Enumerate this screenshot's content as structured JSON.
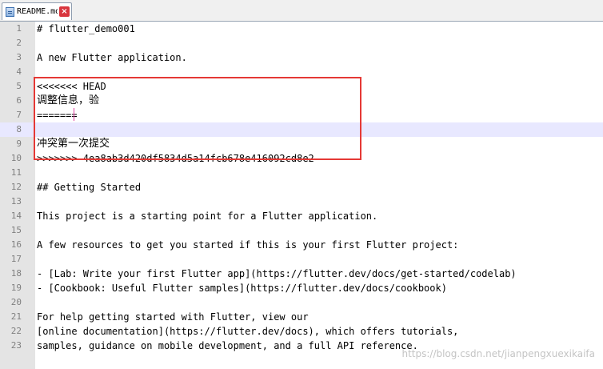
{
  "tab": {
    "label": "README.md",
    "icon": "document-icon",
    "close_icon": "close-icon",
    "close_glyph": "×"
  },
  "editor": {
    "current_line": 8,
    "lines": [
      {
        "n": "1",
        "text": "# flutter_demo001"
      },
      {
        "n": "2",
        "text": ""
      },
      {
        "n": "3",
        "text": "A new Flutter application."
      },
      {
        "n": "4",
        "text": ""
      },
      {
        "n": "5",
        "text": "<<<<<<< HEAD"
      },
      {
        "n": "6",
        "text": "调整信息，验"
      },
      {
        "n": "7",
        "text": "======="
      },
      {
        "n": "8",
        "text": ""
      },
      {
        "n": "9",
        "text": "冲突第一次提交"
      },
      {
        "n": "10",
        "text": ">>>>>>> 4ea8ab3d420df5834d5a14fcb678e416092cd8e2"
      },
      {
        "n": "11",
        "text": ""
      },
      {
        "n": "12",
        "text": "## Getting Started"
      },
      {
        "n": "13",
        "text": ""
      },
      {
        "n": "14",
        "text": "This project is a starting point for a Flutter application."
      },
      {
        "n": "15",
        "text": ""
      },
      {
        "n": "16",
        "text": "A few resources to get you started if this is your first Flutter project:"
      },
      {
        "n": "17",
        "text": ""
      },
      {
        "n": "18",
        "text": "- [Lab: Write your first Flutter app](https://flutter.dev/docs/get-started/codelab)"
      },
      {
        "n": "19",
        "text": "- [Cookbook: Useful Flutter samples](https://flutter.dev/docs/cookbook)"
      },
      {
        "n": "20",
        "text": ""
      },
      {
        "n": "21",
        "text": "For help getting started with Flutter, view our"
      },
      {
        "n": "22",
        "text": "[online documentation](https://flutter.dev/docs), which offers tutorials,"
      },
      {
        "n": "23",
        "text": "samples, guidance on mobile development, and a full API reference."
      }
    ]
  },
  "watermark": "https://blog.csdn.net/jianpengxuexikaifa",
  "colors": {
    "highlight_box": "#e53935",
    "current_line": "#e8e8ff",
    "gutter": "#e4e4e4"
  }
}
